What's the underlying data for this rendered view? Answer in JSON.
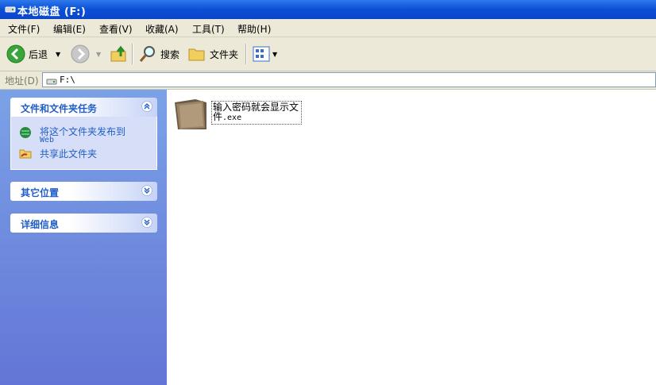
{
  "window": {
    "title": "本地磁盘 (F:)"
  },
  "menu": [
    {
      "label": "文件(F)"
    },
    {
      "label": "编辑(E)"
    },
    {
      "label": "查看(V)"
    },
    {
      "label": "收藏(A)"
    },
    {
      "label": "工具(T)"
    },
    {
      "label": "帮助(H)"
    }
  ],
  "toolbar": {
    "back_label": "后退",
    "search_label": "搜索",
    "folders_label": "文件夹"
  },
  "address": {
    "label": "地址(D)",
    "value": "F:\\"
  },
  "sidebar": {
    "tasks": {
      "title": "文件和文件夹任务",
      "items": [
        {
          "label": "将这个文件夹发布到",
          "sublabel": "Web",
          "icon": "globe-icon"
        },
        {
          "label": "共享此文件夹",
          "icon": "shared-folder-icon"
        }
      ]
    },
    "other_places": {
      "title": "其它位置"
    },
    "details": {
      "title": "详细信息"
    }
  },
  "files": [
    {
      "name": "输入密码就会显示文件",
      "ext": ".exe",
      "icon": "folder-exe-icon"
    }
  ],
  "colors": {
    "titlebar": "#0a4fd6",
    "sidebar": "#7ba2e7",
    "link": "#215dc6"
  }
}
